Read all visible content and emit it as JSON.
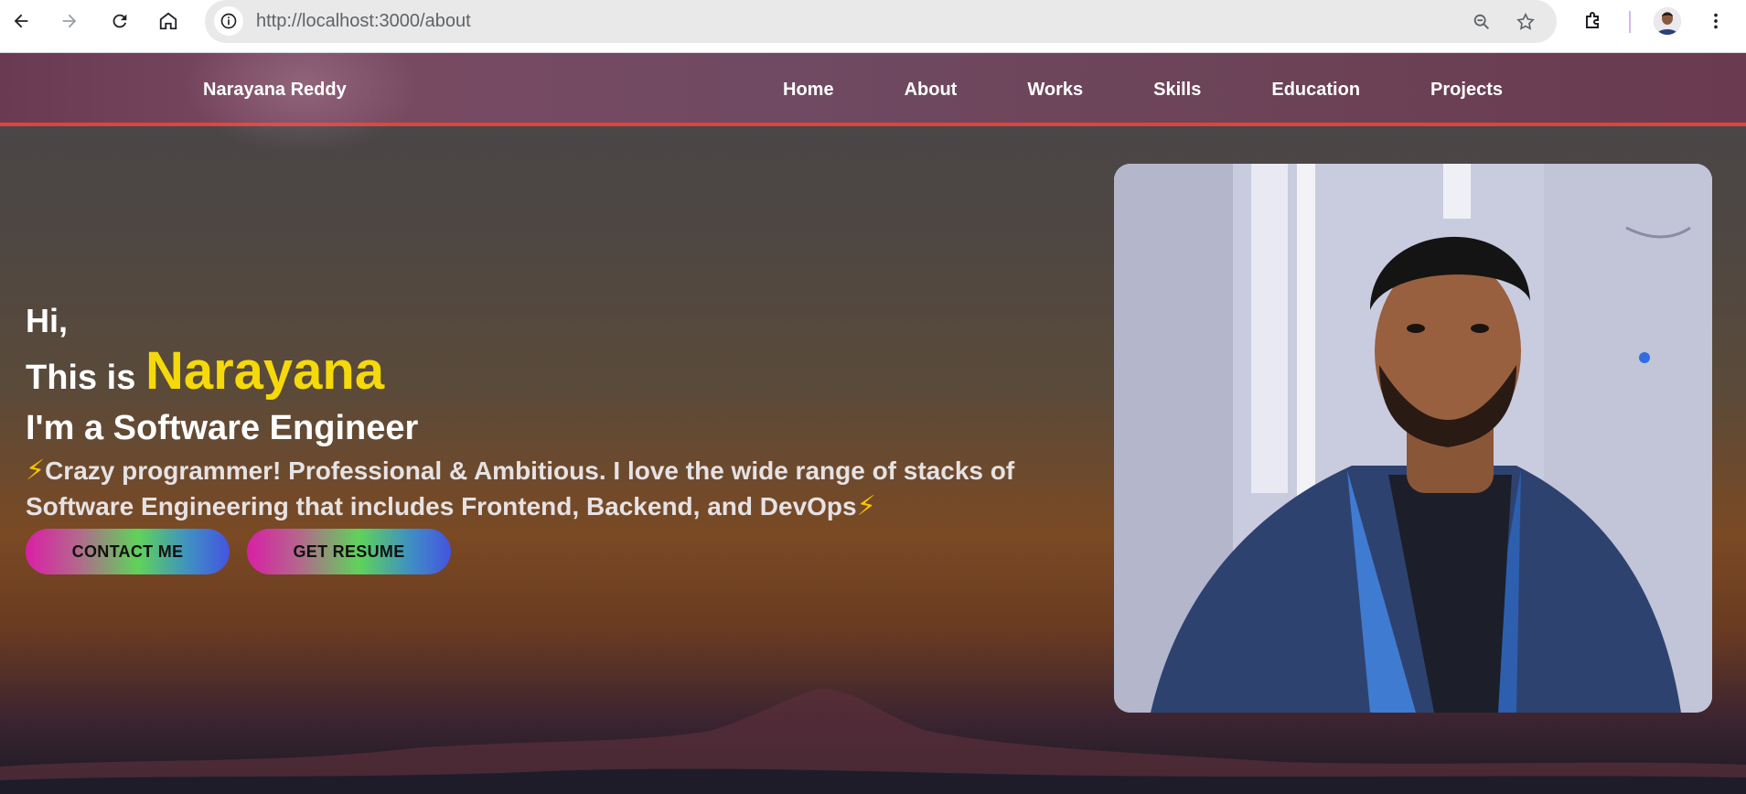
{
  "browser": {
    "url": "http://localhost:3000/about",
    "back_icon": "arrow-left-icon",
    "forward_icon": "arrow-right-icon",
    "reload_icon": "reload-icon",
    "home_icon": "home-icon",
    "site_info_icon": "info-icon",
    "zoom_icon": "zoom-out-icon",
    "bookmark_icon": "star-icon",
    "extensions_icon": "puzzle-icon",
    "menu_icon": "kebab-menu-icon"
  },
  "navbar": {
    "brand": "Narayana Reddy",
    "links": [
      "Home",
      "About",
      "Works",
      "Skills",
      "Education",
      "Projects"
    ]
  },
  "hero": {
    "greeting": "Hi,",
    "this_is": "This is",
    "name": "Narayana",
    "role": "I'm a Software Engineer",
    "bolt": "⚡",
    "description": "Crazy programmer! Professional & Ambitious. I love the wide range of stacks of Software Engineering that includes Frontend, Backend, and DevOps",
    "contact_label": "CONTACT ME",
    "resume_label": "GET RESUME"
  },
  "colors": {
    "accent_name": "#f5d90a",
    "navbar_border": "#e0433b"
  }
}
